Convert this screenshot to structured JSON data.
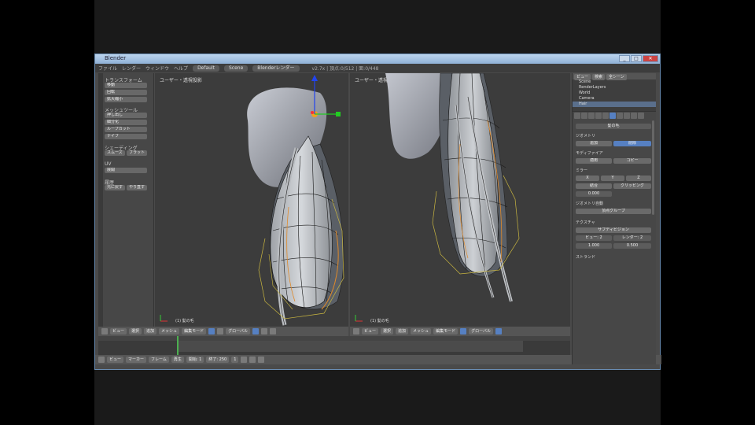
{
  "window": {
    "title": "Blender"
  },
  "menubar": {
    "items": [
      "ファイル",
      "レンダー",
      "ウィンドウ",
      "ヘルプ"
    ],
    "layout_field": "Default",
    "scene_field": "Scene",
    "engine_field": "Blenderレンダー",
    "info": "v2.7x | 頂点:0/512 | 面:0/448"
  },
  "toolshelf": {
    "sections": [
      "トランスフォーム",
      "メッシュツール",
      "シェーディング",
      "UV",
      "履歴"
    ],
    "buttons": [
      "移動",
      "回転",
      "拡大縮小",
      "押し出し",
      "細分化",
      "ループカット",
      "ナイフ",
      "スムーズ",
      "フラット",
      "展開",
      "元に戻す",
      "やり直す"
    ]
  },
  "viewport_left": {
    "label": "ユーザー・透視投影",
    "object": "(1) 髪の毛"
  },
  "viewport_right": {
    "label": "ユーザー・透視投影",
    "object": "(1) 髪の毛"
  },
  "header_left": {
    "items": [
      "ビュー",
      "選択",
      "追加",
      "メッシュ",
      "編集モード",
      "グローバル"
    ]
  },
  "header_right": {
    "items": [
      "ビュー",
      "選択",
      "追加",
      "メッシュ",
      "編集モード",
      "グローバル"
    ]
  },
  "bottombar": {
    "items": [
      "ビュー",
      "マーカー",
      "フレーム",
      "再生",
      "開始: 1",
      "終了: 250",
      "1"
    ]
  },
  "outliner": {
    "header": [
      "ビュー",
      "検索",
      "全シーン"
    ],
    "rows": [
      "Scene",
      "RenderLayers",
      "World",
      "Camera",
      "Hair"
    ]
  },
  "properties": {
    "object_name": "髪の毛",
    "sections": [
      "ジオメトリ",
      "モディファイア",
      "ミラー",
      "ジオメトリ自動",
      "テクスチャ",
      "ストランド"
    ],
    "buttons": [
      "追加",
      "削除",
      "適用",
      "コピー",
      "X",
      "Y",
      "Z",
      "結合",
      "クリッピング",
      "頂点グループ",
      "サブディビジョン",
      "ビュー: 2",
      "レンダー: 2"
    ],
    "fields": [
      "0.000",
      "1.000",
      "0.500"
    ]
  },
  "colors": {
    "accent": "#5680c2",
    "mesh": "#8a8d90",
    "wire": "#1a1a1a",
    "selected": "#e08a2a",
    "guides": "#c9b640"
  }
}
